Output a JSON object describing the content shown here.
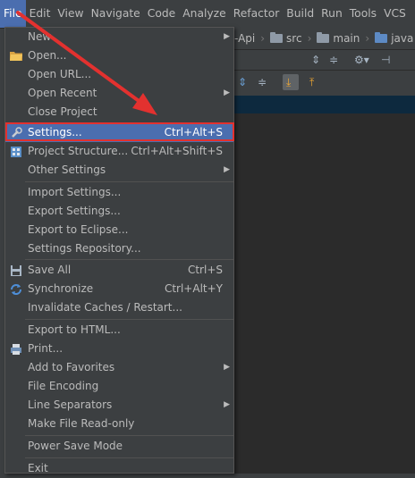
{
  "menubar": {
    "items": [
      {
        "label": "File"
      },
      {
        "label": "Edit"
      },
      {
        "label": "View"
      },
      {
        "label": "Navigate"
      },
      {
        "label": "Code"
      },
      {
        "label": "Analyze"
      },
      {
        "label": "Refactor"
      },
      {
        "label": "Build"
      },
      {
        "label": "Run"
      },
      {
        "label": "Tools"
      },
      {
        "label": "VCS"
      }
    ]
  },
  "navbar": {
    "crumbs": [
      {
        "label": "-Api"
      },
      {
        "label": "src"
      },
      {
        "label": "main"
      },
      {
        "label": "java"
      }
    ]
  },
  "file_menu": {
    "items": [
      {
        "label": "New",
        "shortcut": "",
        "submenu": true,
        "icon": ""
      },
      {
        "label": "Open...",
        "shortcut": "",
        "submenu": false,
        "icon": "folder-open-icon"
      },
      {
        "label": "Open URL...",
        "shortcut": "",
        "submenu": false,
        "icon": ""
      },
      {
        "label": "Open Recent",
        "shortcut": "",
        "submenu": true,
        "icon": ""
      },
      {
        "label": "Close Project",
        "shortcut": "",
        "submenu": false,
        "icon": ""
      },
      {
        "label": "Settings...",
        "shortcut": "Ctrl+Alt+S",
        "submenu": false,
        "icon": "wrench-icon"
      },
      {
        "label": "Project Structure...",
        "shortcut": "Ctrl+Alt+Shift+S",
        "submenu": false,
        "icon": "project-structure-icon"
      },
      {
        "label": "Other Settings",
        "shortcut": "",
        "submenu": true,
        "icon": ""
      },
      {
        "label": "Import Settings...",
        "shortcut": "",
        "submenu": false,
        "icon": ""
      },
      {
        "label": "Export Settings...",
        "shortcut": "",
        "submenu": false,
        "icon": ""
      },
      {
        "label": "Export to Eclipse...",
        "shortcut": "",
        "submenu": false,
        "icon": ""
      },
      {
        "label": "Settings Repository...",
        "shortcut": "",
        "submenu": false,
        "icon": ""
      },
      {
        "label": "Save All",
        "shortcut": "Ctrl+S",
        "submenu": false,
        "icon": "save-all-icon"
      },
      {
        "label": "Synchronize",
        "shortcut": "Ctrl+Alt+Y",
        "submenu": false,
        "icon": "synchronize-icon"
      },
      {
        "label": "Invalidate Caches / Restart...",
        "shortcut": "",
        "submenu": false,
        "icon": ""
      },
      {
        "label": "Export to HTML...",
        "shortcut": "",
        "submenu": false,
        "icon": ""
      },
      {
        "label": "Print...",
        "shortcut": "",
        "submenu": false,
        "icon": "printer-icon"
      },
      {
        "label": "Add to Favorites",
        "shortcut": "",
        "submenu": true,
        "icon": ""
      },
      {
        "label": "File Encoding",
        "shortcut": "",
        "submenu": false,
        "icon": ""
      },
      {
        "label": "Line Separators",
        "shortcut": "",
        "submenu": true,
        "icon": ""
      },
      {
        "label": "Make File Read-only",
        "shortcut": "",
        "submenu": false,
        "icon": ""
      },
      {
        "label": "Power Save Mode",
        "shortcut": "",
        "submenu": false,
        "icon": ""
      },
      {
        "label": "Exit",
        "shortcut": "",
        "submenu": false,
        "icon": ""
      }
    ]
  },
  "colors": {
    "menu_bg": "#3c3f41",
    "selection": "#4b6eaf",
    "annotation": "#e3312f",
    "text": "#bbbbbb"
  }
}
